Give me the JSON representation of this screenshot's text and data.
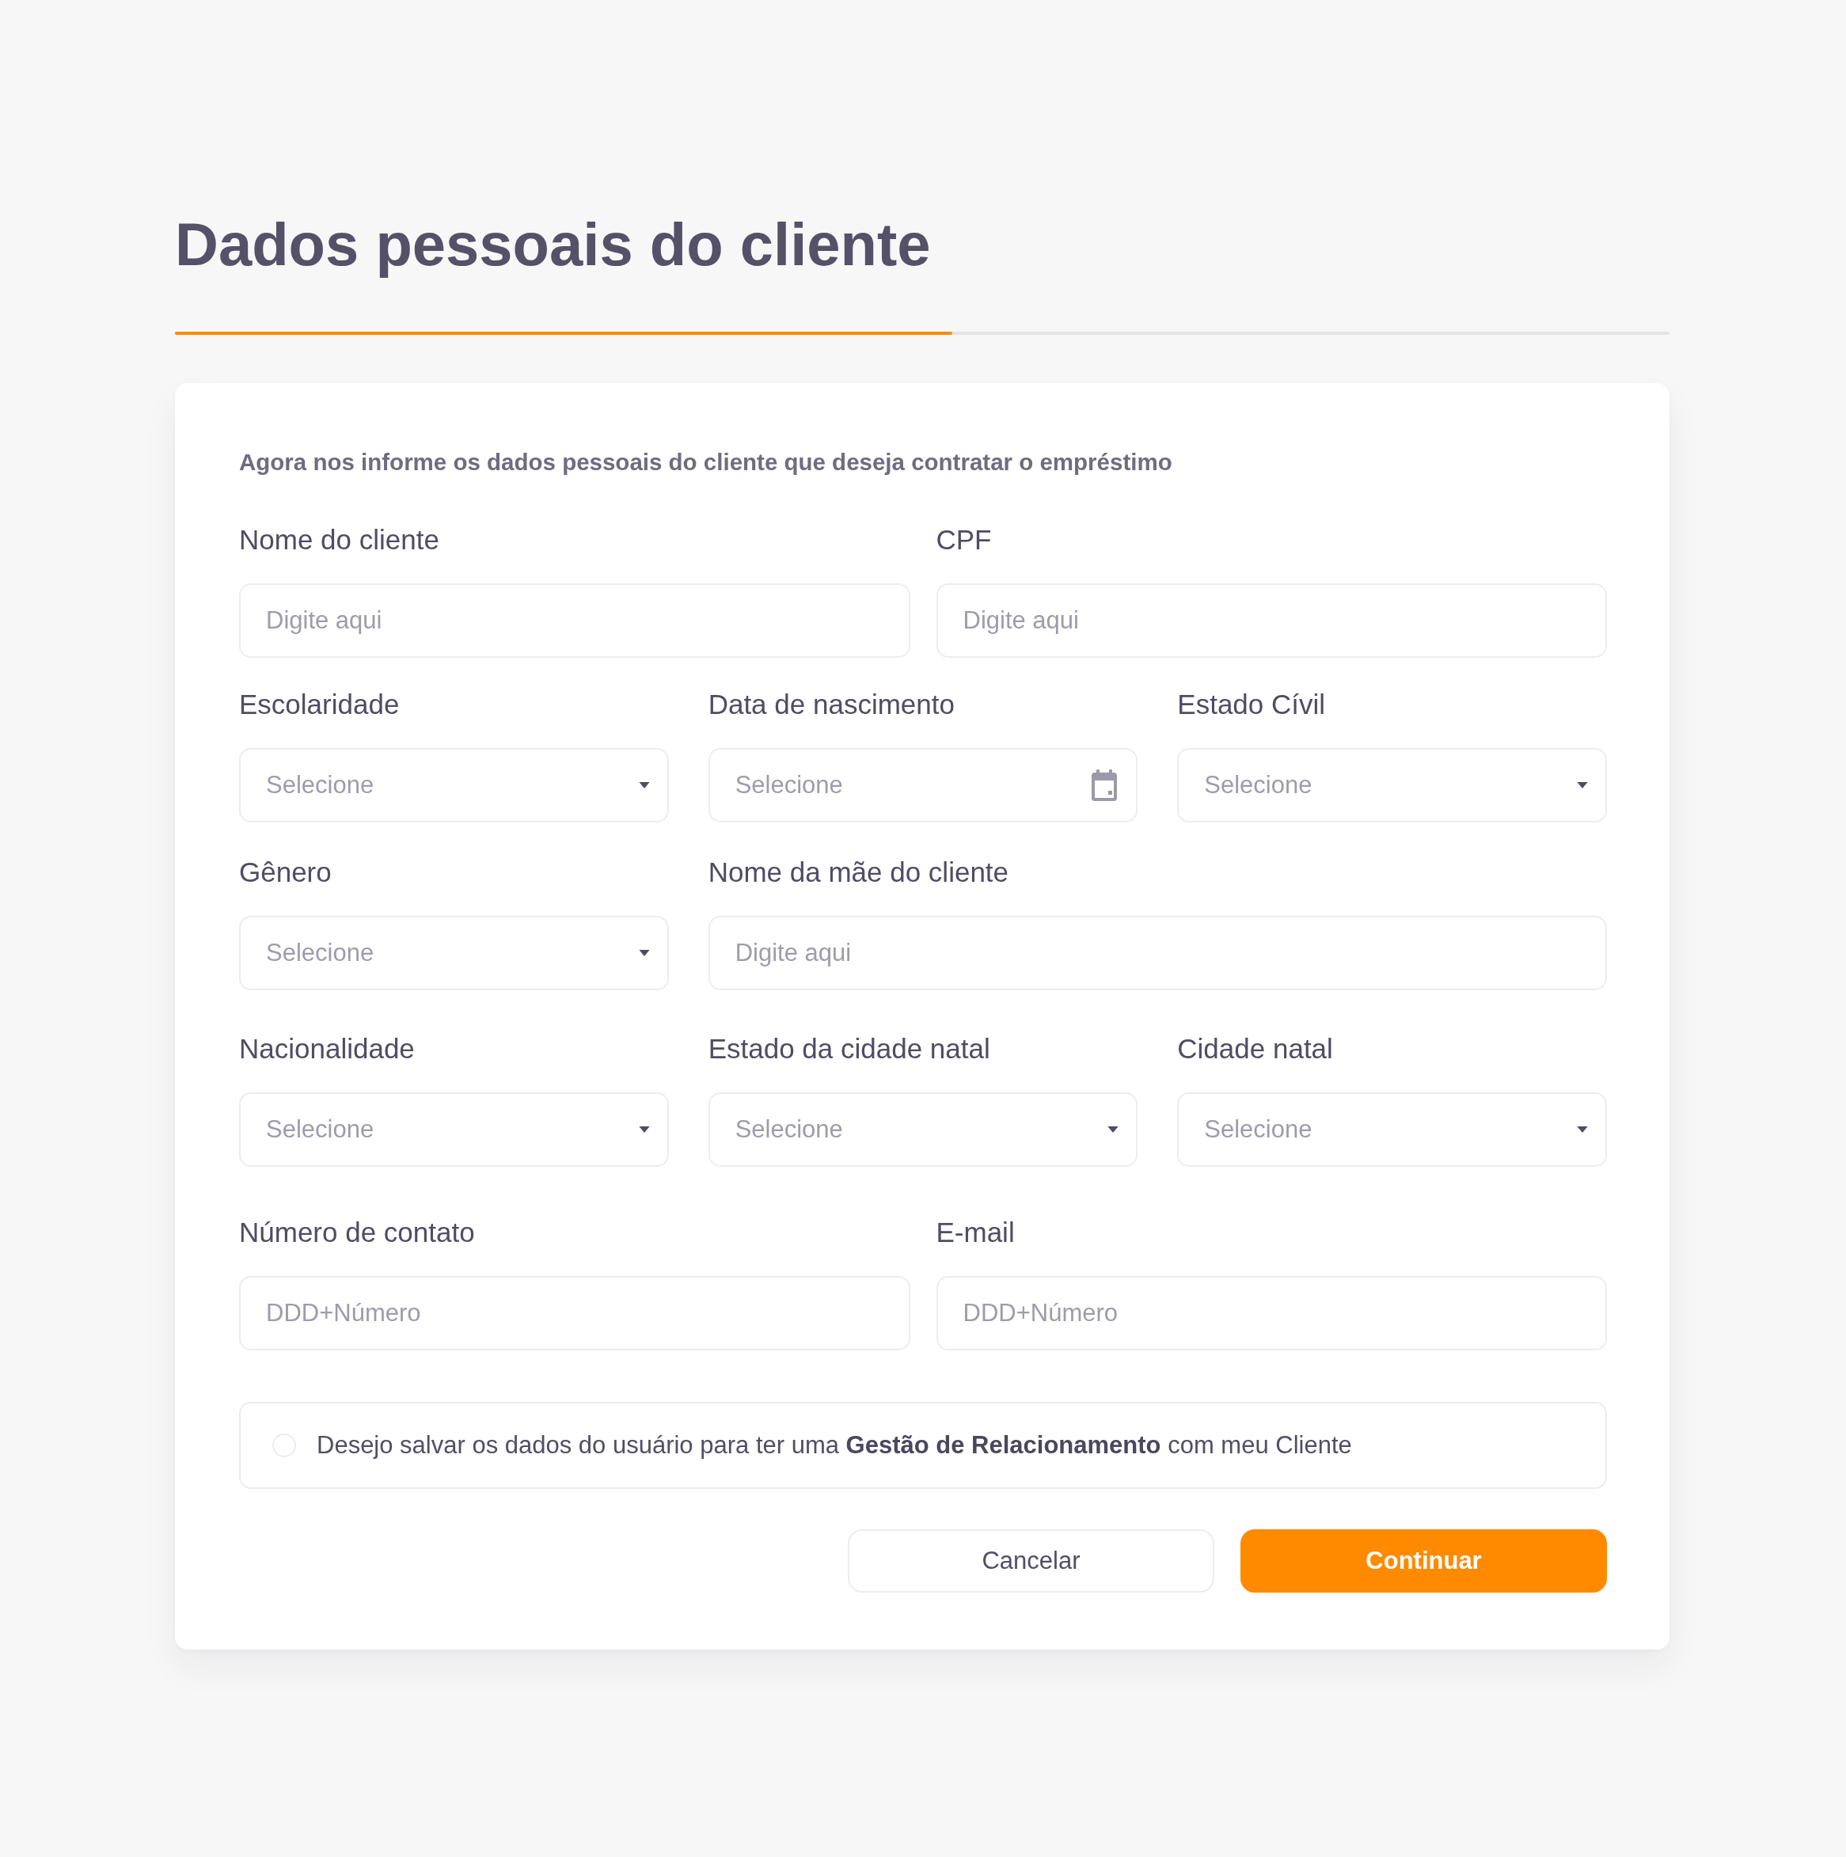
{
  "page": {
    "title": "Dados pessoais do cliente"
  },
  "progress": {
    "level": 0.52
  },
  "form": {
    "intro": "Agora nos informe os dados pessoais do cliente que deseja contratar o empréstimo",
    "rows": [
      {
        "fields": [
          {
            "label": "Nome do cliente",
            "kind": "text",
            "placeholder": "Digite aqui"
          },
          {
            "label": "CPF",
            "kind": "text",
            "placeholder": "Digite aqui"
          }
        ]
      },
      {
        "fields": [
          {
            "label": "Escolaridade",
            "kind": "select",
            "placeholder": "Selecione"
          },
          {
            "label": "Data de nascimento",
            "kind": "date",
            "placeholder": "Selecione"
          },
          {
            "label": "Estado Cívil",
            "kind": "select",
            "placeholder": "Selecione"
          }
        ]
      },
      {
        "fields": [
          {
            "label": "Gênero",
            "kind": "select",
            "placeholder": "Selecione"
          },
          {
            "label": "Nome da mãe do cliente",
            "kind": "text",
            "placeholder": "Digite aqui"
          }
        ]
      },
      {
        "fields": [
          {
            "label": "Nacionalidade",
            "kind": "select",
            "placeholder": "Selecione"
          },
          {
            "label": "Estado da cidade natal",
            "kind": "select",
            "placeholder": "Selecione"
          },
          {
            "label": "Cidade natal",
            "kind": "select",
            "placeholder": "Selecione"
          }
        ]
      },
      {
        "fields": [
          {
            "label": "Número de contato",
            "kind": "text",
            "placeholder": "DDD+Número"
          },
          {
            "label": "E-mail",
            "kind": "text",
            "placeholder": "DDD+Número"
          }
        ]
      }
    ],
    "consent": {
      "checked": false,
      "text": "Desejo salvar os dados do usuário para ter uma **Gestão de Relacionamento** com meu Cliente"
    },
    "buttons": [
      {
        "kind": "secondary",
        "label": "Cancelar"
      },
      {
        "kind": "primary",
        "label": "Continuar"
      }
    ]
  }
}
